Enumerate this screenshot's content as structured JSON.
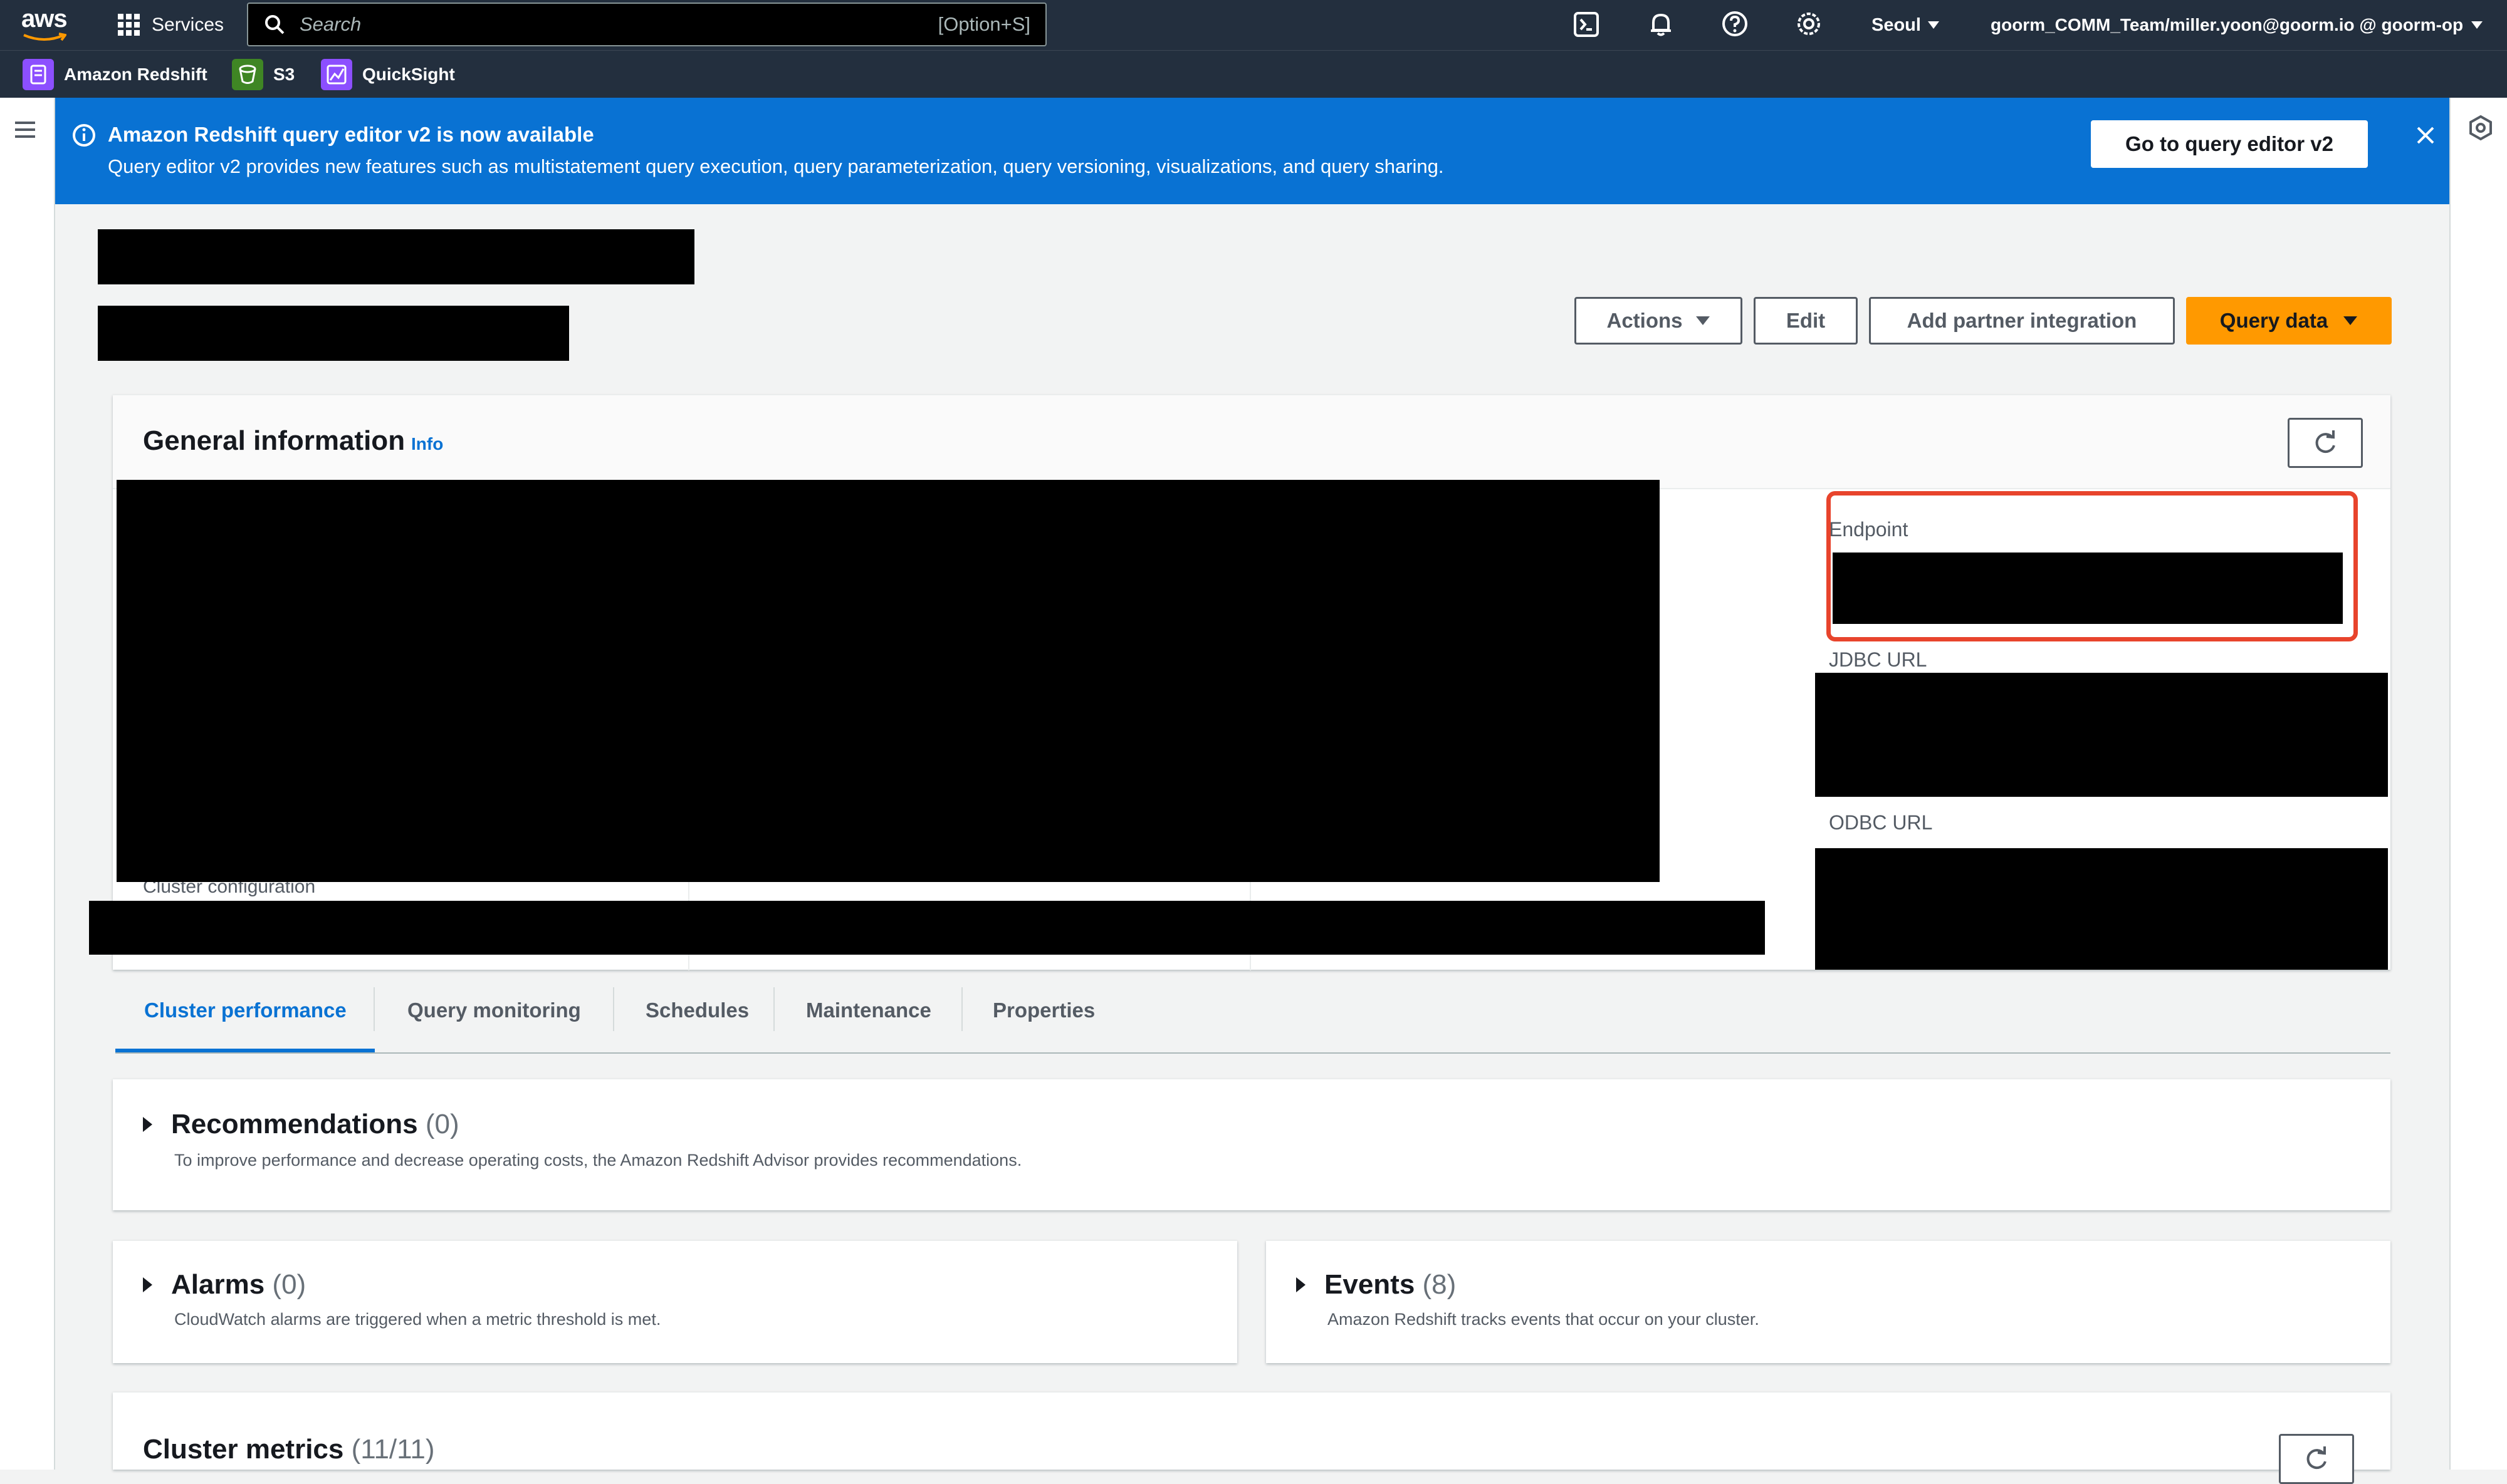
{
  "topnav": {
    "logo": "aws",
    "services_label": "Services",
    "search_placeholder": "Search",
    "search_shortcut": "[Option+S]",
    "region": "Seoul",
    "account": "goorm_COMM_Team/miller.yoon@goorm.io @ goorm-op"
  },
  "favorites": [
    {
      "label": "Amazon Redshift",
      "icon": "redshift-icon",
      "color": "#8c4fff"
    },
    {
      "label": "S3",
      "icon": "s3-icon",
      "color": "#3f8624"
    },
    {
      "label": "QuickSight",
      "icon": "quicksight-icon",
      "color": "#8c4fff"
    }
  ],
  "banner": {
    "title": "Amazon Redshift query editor v2 is now available",
    "text": "Query editor v2 provides new features such as multistatement query execution, query parameterization, query versioning, visualizations, and query sharing.",
    "button": "Go to query editor v2"
  },
  "header_actions": {
    "actions": "Actions",
    "edit": "Edit",
    "add_partner": "Add partner integration",
    "query_data": "Query data"
  },
  "general_info": {
    "title": "General information",
    "info_link": "Info",
    "cluster_configuration": "Cluster configuration",
    "endpoint_label": "Endpoint",
    "jdbc_label": "JDBC URL",
    "odbc_label": "ODBC URL"
  },
  "tabs": [
    "Cluster performance",
    "Query monitoring",
    "Schedules",
    "Maintenance",
    "Properties"
  ],
  "active_tab": "Cluster performance",
  "recommendations": {
    "title": "Recommendations",
    "count": "(0)",
    "desc": "To improve performance and decrease operating costs, the Amazon Redshift Advisor provides recommendations."
  },
  "alarms": {
    "title": "Alarms",
    "count": "(0)",
    "desc": "CloudWatch alarms are triggered when a metric threshold is met."
  },
  "events": {
    "title": "Events",
    "count": "(8)",
    "desc": "Amazon Redshift tracks events that occur on your cluster."
  },
  "cluster_metrics": {
    "title": "Cluster metrics",
    "count": "(11/11)"
  },
  "colors": {
    "nav_bg": "#232f3e",
    "banner_bg": "#0972d3",
    "primary_button": "#ff9900",
    "link": "#0972d3",
    "highlight_box": "#e8442c"
  }
}
